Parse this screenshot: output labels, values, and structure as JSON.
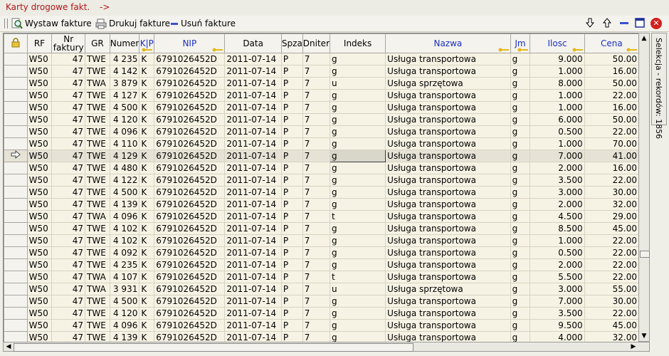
{
  "window": {
    "title": "Karty drogowe fakt.",
    "title_suffix": "->"
  },
  "toolbar": {
    "issue_label": "Wystaw fakture",
    "print_label": "Drukuj fakture",
    "delete_label": "Usuń fakture"
  },
  "side_tab": {
    "label": "Selekcja - rekordów: 1856"
  },
  "table": {
    "columns": [
      "",
      "RF",
      "Nr faktury",
      "GR",
      "Numer",
      "K|P",
      "NIP",
      "Data",
      "Spza",
      "Dniter",
      "Indeks",
      "Nazwa",
      "Jm",
      "Ilosc",
      "Cena"
    ],
    "rows": [
      [
        "W50",
        "47",
        "TWE",
        "4 235",
        "K",
        "6791026452D",
        "2011-07-14",
        "P",
        "7",
        "g",
        "Usługa transportowa",
        "g",
        "9.000",
        "50.00"
      ],
      [
        "W50",
        "47",
        "TWE",
        "4 142",
        "K",
        "6791026452D",
        "2011-07-14",
        "P",
        "7",
        "g",
        "Usługa transportowa",
        "g",
        "1.000",
        "16.00"
      ],
      [
        "W50",
        "47",
        "TWA",
        "3 879",
        "K",
        "6791026452D",
        "2011-07-14",
        "P",
        "7",
        "u",
        "Usługa sprzętowa",
        "g",
        "8.000",
        "50.00"
      ],
      [
        "W50",
        "47",
        "TWE",
        "4 127",
        "K",
        "6791026452D",
        "2011-07-14",
        "P",
        "7",
        "g",
        "Usługa transportowa",
        "g",
        "1.000",
        "22.00"
      ],
      [
        "W50",
        "47",
        "TWE",
        "4 500",
        "K",
        "6791026452D",
        "2011-07-14",
        "P",
        "7",
        "g",
        "Usługa transportowa",
        "g",
        "1.000",
        "16.00"
      ],
      [
        "W50",
        "47",
        "TWE",
        "4 120",
        "K",
        "6791026452D",
        "2011-07-14",
        "P",
        "7",
        "g",
        "Usługa transportowa",
        "g",
        "6.000",
        "50.00"
      ],
      [
        "W50",
        "47",
        "TWE",
        "4 096",
        "K",
        "6791026452D",
        "2011-07-14",
        "P",
        "7",
        "g",
        "Usługa transportowa",
        "g",
        "0.500",
        "22.00"
      ],
      [
        "W50",
        "47",
        "TWE",
        "4 110",
        "K",
        "6791026452D",
        "2011-07-14",
        "P",
        "7",
        "g",
        "Usługa transportowa",
        "g",
        "1.000",
        "70.00"
      ],
      [
        "W50",
        "47",
        "TWE",
        "4 129",
        "K",
        "6791026452D",
        "2011-07-14",
        "P",
        "7",
        "g",
        "Usługa transportowa",
        "g",
        "7.000",
        "41.00"
      ],
      [
        "W50",
        "47",
        "TWE",
        "4 480",
        "K",
        "6791026452D",
        "2011-07-14",
        "P",
        "7",
        "g",
        "Usługa transportowa",
        "g",
        "2.000",
        "16.00"
      ],
      [
        "W50",
        "47",
        "TWE",
        "4 122",
        "K",
        "6791026452D",
        "2011-07-14",
        "P",
        "7",
        "g",
        "Usługa transportowa",
        "g",
        "3.500",
        "22.00"
      ],
      [
        "W50",
        "47",
        "TWE",
        "4 500",
        "K",
        "6791026452D",
        "2011-07-14",
        "P",
        "7",
        "g",
        "Usługa transportowa",
        "g",
        "3.000",
        "30.00"
      ],
      [
        "W50",
        "47",
        "TWE",
        "4 139",
        "K",
        "6791026452D",
        "2011-07-14",
        "P",
        "7",
        "g",
        "Usługa transportowa",
        "g",
        "2.000",
        "32.00"
      ],
      [
        "W50",
        "47",
        "TWA",
        "4 096",
        "K",
        "6791026452D",
        "2011-07-14",
        "P",
        "7",
        "t",
        "Usługa transportowa",
        "g",
        "4.500",
        "29.00"
      ],
      [
        "W50",
        "47",
        "TWE",
        "4 102",
        "K",
        "6791026452D",
        "2011-07-14",
        "P",
        "7",
        "g",
        "Usługa transportowa",
        "g",
        "8.500",
        "45.00"
      ],
      [
        "W50",
        "47",
        "TWE",
        "4 102",
        "K",
        "6791026452D",
        "2011-07-14",
        "P",
        "7",
        "g",
        "Usługa transportowa",
        "g",
        "1.000",
        "22.00"
      ],
      [
        "W50",
        "47",
        "TWE",
        "4 092",
        "K",
        "6791026452D",
        "2011-07-14",
        "P",
        "7",
        "g",
        "Usługa transportowa",
        "g",
        "0.500",
        "22.00"
      ],
      [
        "W50",
        "47",
        "TWE",
        "4 235",
        "K",
        "6791026452D",
        "2011-07-14",
        "P",
        "7",
        "g",
        "Usługa transportowa",
        "g",
        "2.000",
        "22.00"
      ],
      [
        "W50",
        "47",
        "TWA",
        "4 107",
        "K",
        "6791026452D",
        "2011-07-14",
        "P",
        "7",
        "t",
        "Usługa transportowa",
        "g",
        "5.500",
        "22.00"
      ],
      [
        "W50",
        "47",
        "TWA",
        "3 931",
        "K",
        "6791026452D",
        "2011-07-14",
        "P",
        "7",
        "u",
        "Usługa sprzętowa",
        "g",
        "3.000",
        "55.00"
      ],
      [
        "W50",
        "47",
        "TWE",
        "4 500",
        "K",
        "6791026452D",
        "2011-07-14",
        "P",
        "7",
        "g",
        "Usługa transportowa",
        "g",
        "7.000",
        "30.00"
      ],
      [
        "W50",
        "47",
        "TWE",
        "4 120",
        "K",
        "6791026452D",
        "2011-07-14",
        "P",
        "7",
        "g",
        "Usługa transportowa",
        "g",
        "3.500",
        "22.00"
      ],
      [
        "W50",
        "47",
        "TWE",
        "4 096",
        "K",
        "6791026452D",
        "2011-07-14",
        "P",
        "7",
        "g",
        "Usługa transportowa",
        "g",
        "9.500",
        "45.00"
      ],
      [
        "W50",
        "47",
        "TWE",
        "4 139",
        "K",
        "6791026452D",
        "2011-07-14",
        "P",
        "7",
        "g",
        "Usługa transportowa",
        "g",
        "4.000",
        "32.00"
      ]
    ],
    "current_row": 8
  },
  "colors": {
    "title_red": "#b11616",
    "header_blue": "#1a2fc4",
    "row_bg": "#f7f3e4",
    "close_red": "#d41e1e"
  },
  "icons": [
    "lock-icon",
    "search-icon",
    "print-icon",
    "delete-icon",
    "arrow-down-icon",
    "arrow-up-icon",
    "minimize-icon",
    "maximize-icon",
    "close-icon",
    "row-pointer-icon",
    "key-icon"
  ]
}
